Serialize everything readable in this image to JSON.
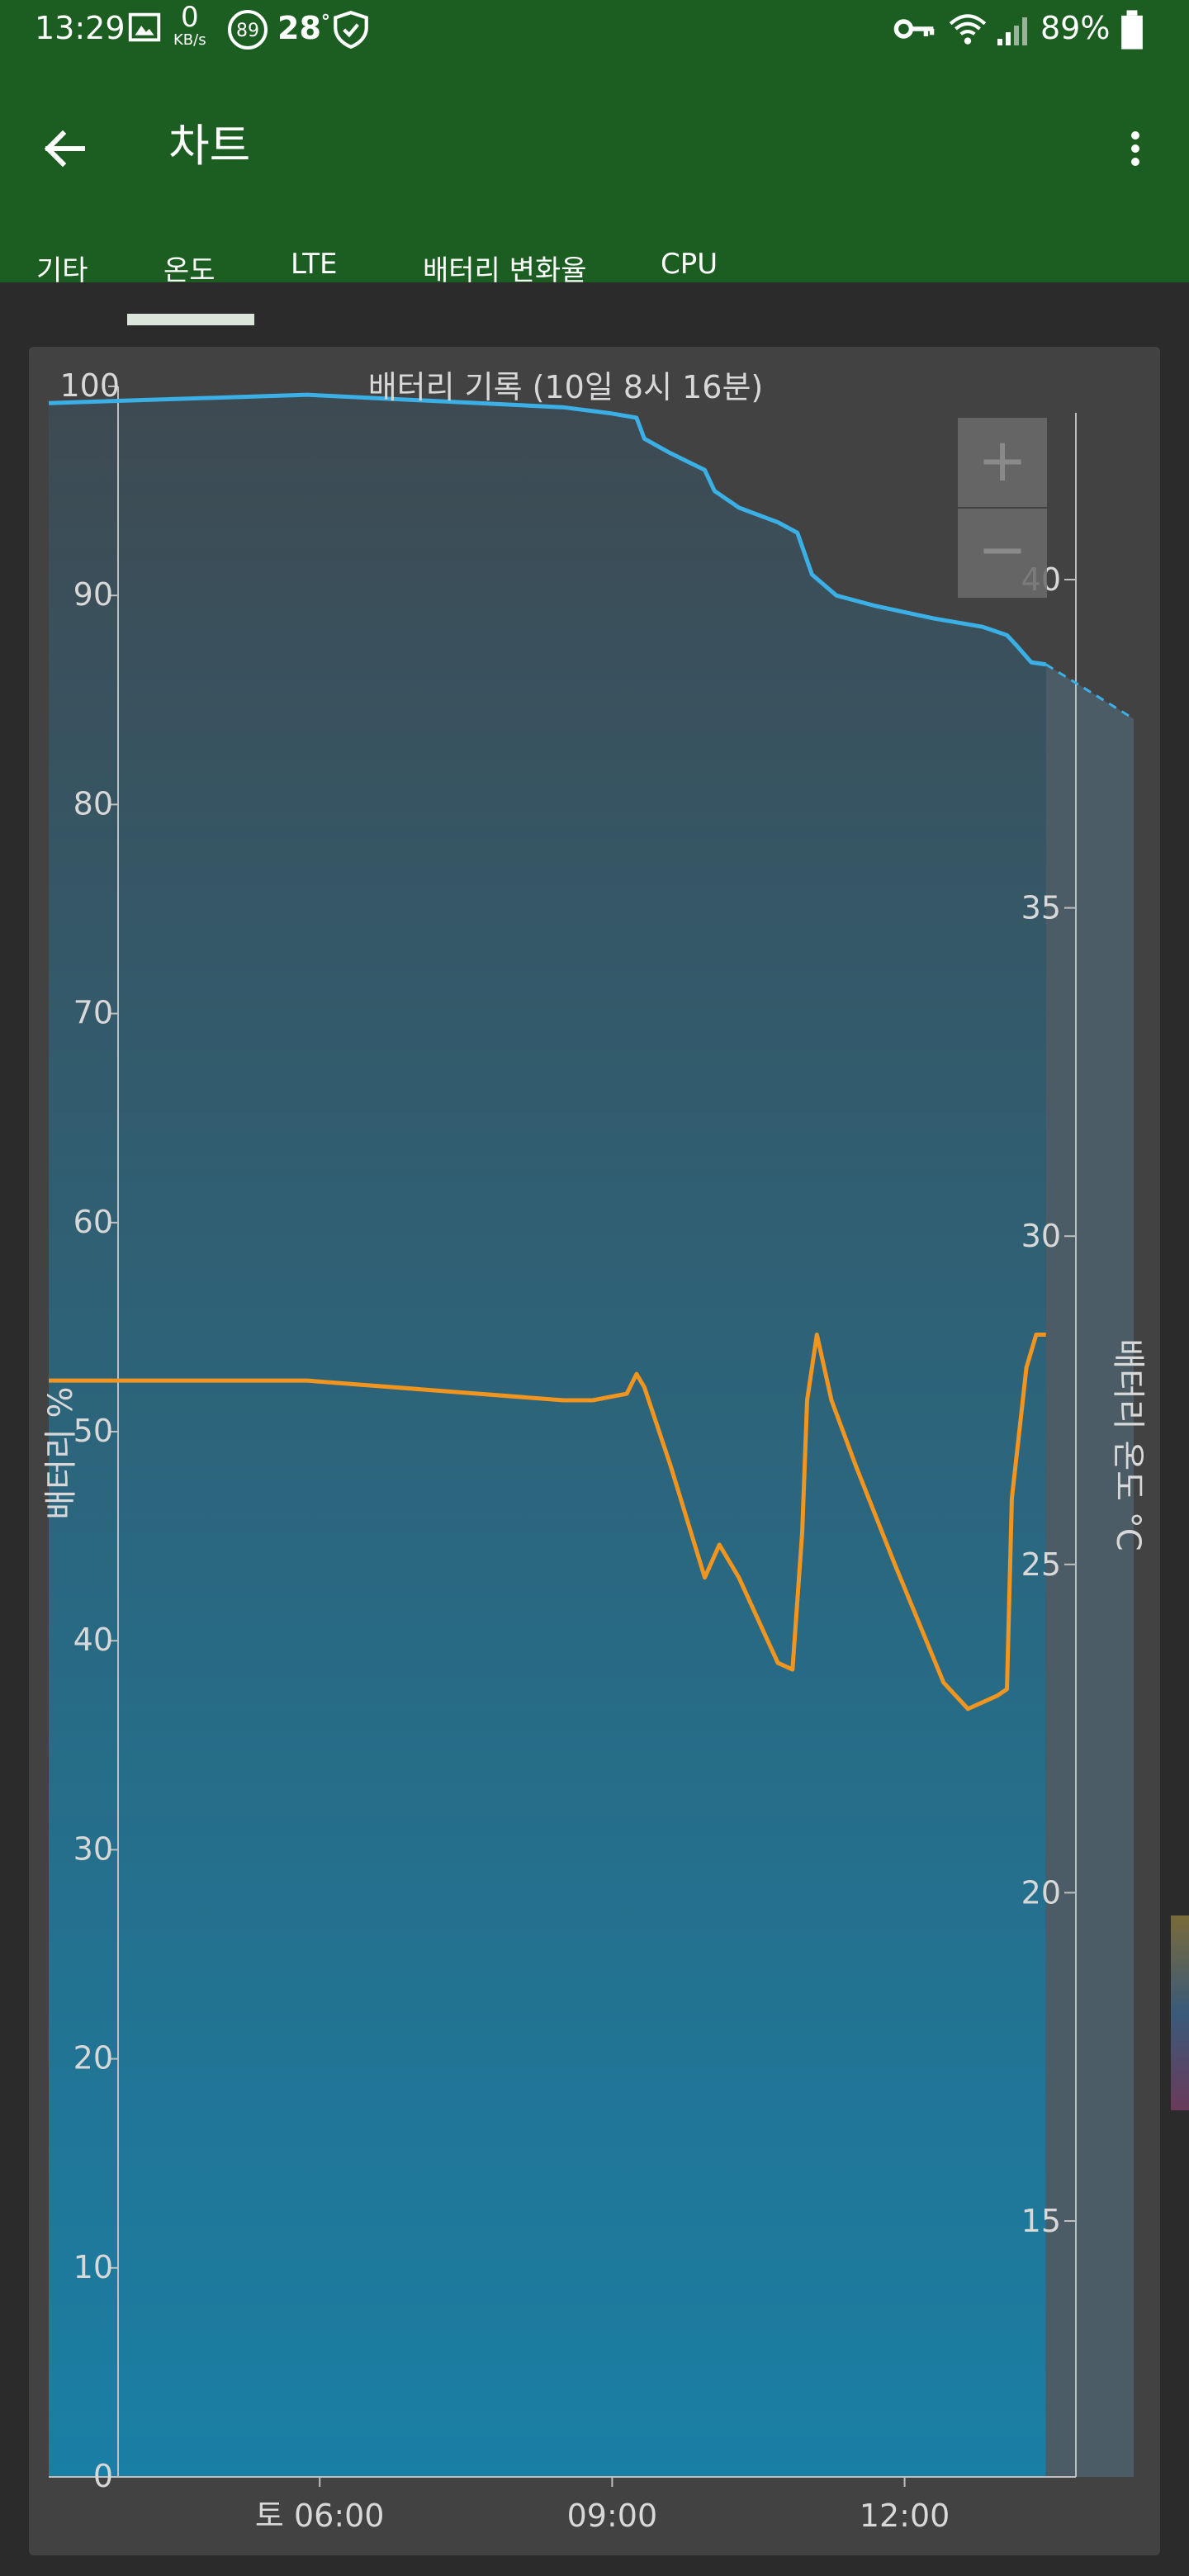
{
  "status_bar": {
    "time": "13:29",
    "net_speed": "0",
    "net_unit": "KB/s",
    "badge_value": "89",
    "temperature": "28",
    "temp_unit": "°",
    "battery_percent": "89%"
  },
  "app_bar": {
    "title": "차트"
  },
  "tabs": [
    {
      "label": "기타",
      "selected": false
    },
    {
      "label": "온도",
      "selected": true
    },
    {
      "label": "LTE",
      "selected": false
    },
    {
      "label": "배터리 변화율",
      "selected": false
    },
    {
      "label": "CPU",
      "selected": false
    }
  ],
  "zoom": {
    "plus": "+",
    "minus": "−"
  },
  "colors": {
    "app_bar": "#1c5e22",
    "battery_line": "#3bb0e6",
    "temperature_line": "#f2951f",
    "plot_top": "#3e4a52",
    "plot_bottom": "#1a7fa5"
  },
  "chart_data": {
    "type": "line",
    "title": "배터리 기록 (10일 8시 16분)",
    "ylabel_left": "배터리 %",
    "ylabel_right": "배터리 온도 °C",
    "x_ticks": [
      "토 06:00",
      "09:00",
      "12:00"
    ],
    "x_tick_hours": [
      6,
      9,
      12
    ],
    "xlim": [
      3.22,
      14.35
    ],
    "ylim_left": [
      0,
      100
    ],
    "yticks_left": [
      0,
      10,
      20,
      30,
      40,
      50,
      60,
      70,
      80,
      90,
      100
    ],
    "ylim_right": [
      11,
      43
    ],
    "yticks_right": [
      15,
      20,
      25,
      30,
      35,
      40
    ],
    "series": [
      {
        "axis": "left",
        "x": [
          3.22,
          5.87,
          8.5,
          9.0,
          9.25,
          9.33,
          9.6,
          9.95,
          10.05,
          10.3,
          10.7,
          10.9,
          11.05,
          11.3,
          11.7,
          12.3,
          12.8,
          13.05,
          13.15,
          13.3,
          13.45
        ],
        "y": [
          99.2,
          99.6,
          99.0,
          98.7,
          98.5,
          97.5,
          96.8,
          96.0,
          95.0,
          94.2,
          93.5,
          93.0,
          91.0,
          90.0,
          89.5,
          88.9,
          88.5,
          88.1,
          87.6,
          86.8,
          86.7
        ]
      },
      {
        "axis": "left",
        "style": "dashed",
        "x": [
          13.45,
          14.35
        ],
        "y": [
          86.7,
          84.1
        ]
      },
      {
        "axis": "right",
        "x": [
          3.22,
          5.87,
          8.5,
          8.8,
          9.15,
          9.25,
          9.33,
          9.6,
          9.95,
          10.1,
          10.3,
          10.7,
          10.85,
          10.95,
          11.0,
          11.1,
          11.25,
          11.5,
          11.9,
          12.4,
          12.65,
          12.95,
          13.05,
          13.1,
          13.25,
          13.35,
          13.45
        ],
        "y": [
          27.8,
          27.8,
          27.5,
          27.5,
          27.6,
          27.9,
          27.7,
          26.5,
          24.8,
          25.3,
          24.8,
          23.5,
          23.4,
          25.5,
          27.5,
          28.5,
          27.5,
          26.5,
          25.0,
          23.2,
          22.8,
          23.0,
          23.1,
          26.0,
          28.0,
          28.5,
          28.5
        ]
      }
    ]
  }
}
